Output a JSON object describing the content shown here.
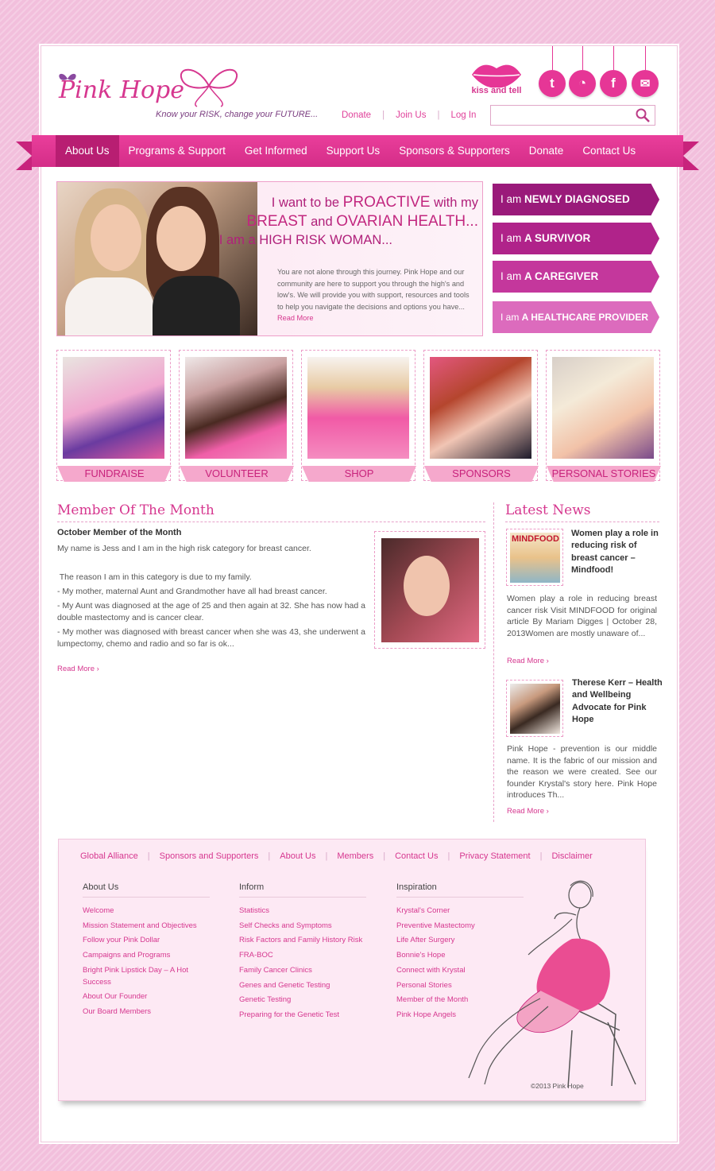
{
  "brand": {
    "logo": "Pink Hope",
    "tagline": "Know your RISK, change your FUTURE...",
    "kiss_label": "kiss and tell"
  },
  "toplinks": [
    "Donate",
    "Join Us",
    "Log In"
  ],
  "search": {
    "placeholder": ""
  },
  "social": [
    "twitter-icon",
    "rss-icon",
    "facebook-icon",
    "mail-icon"
  ],
  "nav": [
    "About Us",
    "Programs & Support",
    "Get Informed",
    "Support Us",
    "Sponsors & Supporters",
    "Donate",
    "Contact Us"
  ],
  "hero": {
    "line1_pre": "I want to be ",
    "line1_em": "PROACTIVE",
    "line1_post": " with my",
    "line2_a": "BREAST",
    "line2_b": " and ",
    "line2_c": "OVARIAN HEALTH...",
    "line3_pre": "I am a ",
    "line3_em": "HIGH RISK WOMAN...",
    "body": "You are not alone through this journey. Pink Hope and our community are here to support you through the high's and low's.  We will provide you with support, resources and tools to help you navigate the decisions and options you have...",
    "read_more": "Read More"
  },
  "ribbons": [
    {
      "pre": "I am ",
      "em": "NEWLY DIAGNOSED",
      "color": "#9a1a7a"
    },
    {
      "pre": "I am ",
      "em": "A SURVIVOR",
      "color": "#b0238a"
    },
    {
      "pre": "I am ",
      "em": "A CAREGIVER",
      "color": "#c4379c"
    },
    {
      "pre": "I am ",
      "em": "A HEALTHCARE PROVIDER",
      "color": "#dc6bbd"
    }
  ],
  "tiles": [
    "FUNDRAISE",
    "VOLUNTEER",
    "SHOP",
    "SPONSORS",
    "PERSONAL STORIES"
  ],
  "member": {
    "title": "Member Of The Month",
    "subtitle": "October Member of the Month",
    "paragraphs": [
      "My name is Jess and I am in the high risk category for breast cancer.",
      "",
      " The reason I am in this category is due to my family.",
      "- My mother, maternal Aunt and Grandmother have all had breast cancer.",
      "- My Aunt was diagnosed at the age of 25 and then again at 32. She has now had a double mastectomy and is cancer clear.",
      "- My mother was diagnosed with breast cancer when she was 43, she underwent a lumpectomy, chemo and radio and so far is ok..."
    ],
    "read_more": "Read More"
  },
  "news": {
    "title": "Latest News",
    "items": [
      {
        "title": "Women play a role in reducing risk of breast cancer – Mindfood!",
        "thumb_label": "MINDFOOD",
        "text": "Women play a role in reducing breast cancer risk Visit MINDFOOD for original article By Mariam Digges | October 28, 2013Women are mostly unaware of...",
        "read_more": "Read More"
      },
      {
        "title": "Therese Kerr – Health and Wellbeing Advocate for Pink Hope",
        "thumb_label": "",
        "text": "Pink Hope - prevention is our middle name. It is the fabric of our mission and the reason we were created. See our founder Krystal's story here. Pink Hope introduces Th...",
        "read_more": "Read More"
      }
    ]
  },
  "footer": {
    "links": [
      "Global Alliance",
      "Sponsors and Supporters",
      "About Us",
      "Members",
      "Contact Us",
      "Privacy Statement",
      "Disclaimer"
    ],
    "columns": [
      {
        "heading": "About Us",
        "items": [
          "Welcome",
          "Mission Statement and Objectives",
          "Follow your Pink Dollar",
          "Campaigns and Programs",
          "Bright Pink Lipstick Day – A Hot",
          "Success",
          "About Our Founder",
          "Our Board Members"
        ]
      },
      {
        "heading": "Inform",
        "items": [
          "Statistics",
          "Self Checks and Symptoms",
          "Risk Factors and Family History Risk",
          "FRA-BOC",
          "Family Cancer Clinics",
          "Genes and Genetic Testing",
          "Genetic Testing",
          "Preparing for the Genetic Test"
        ]
      },
      {
        "heading": "Inspiration",
        "items": [
          "Krystal's Corner",
          "Preventive Mastectomy",
          "Life After Surgery",
          "Bonnie's Hope",
          "Connect with Krystal",
          "Personal Stories",
          "Member of the Month",
          "Pink Hope Angels"
        ]
      }
    ],
    "copyright": "©2013 Pink Hope"
  }
}
